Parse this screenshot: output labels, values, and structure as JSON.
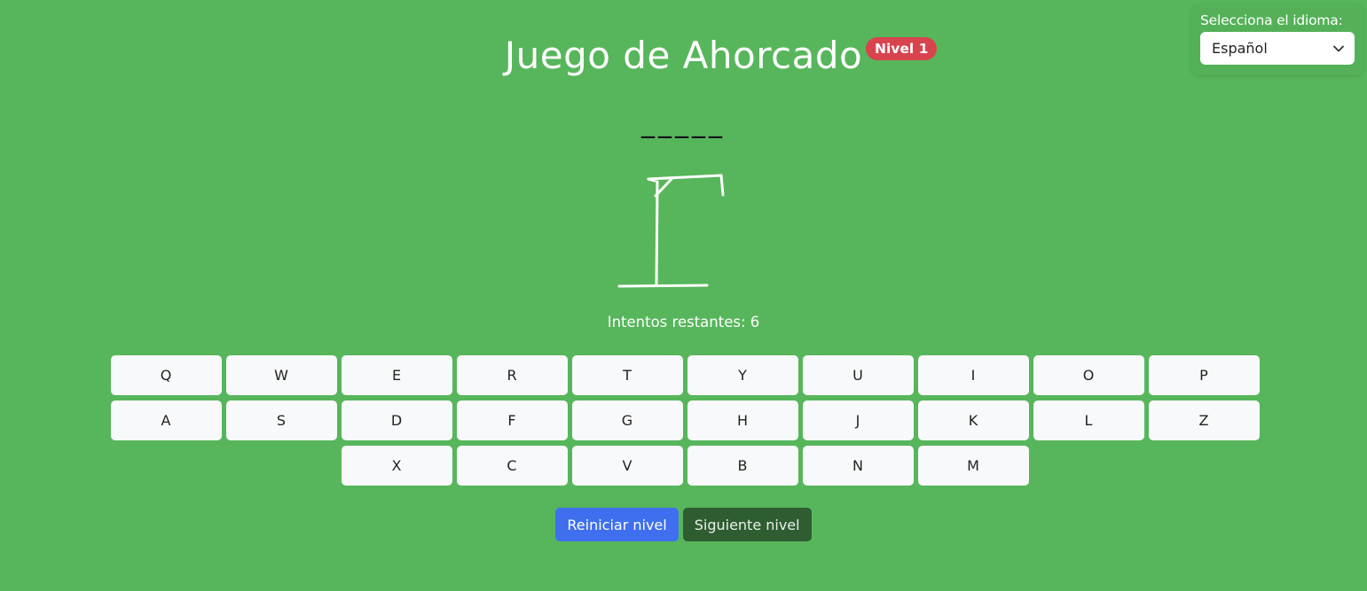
{
  "language": {
    "label": "Selecciona el idioma:",
    "selected": "Español"
  },
  "header": {
    "title": "Juego de Ahorcado",
    "level_badge": "Nivel 1"
  },
  "word_display": "_____",
  "attempts_text": "Intentos restantes: 6",
  "keyboard": {
    "row1": [
      "Q",
      "W",
      "E",
      "R",
      "T",
      "Y",
      "U",
      "I",
      "O",
      "P"
    ],
    "row2": [
      "A",
      "S",
      "D",
      "F",
      "G",
      "H",
      "J",
      "K",
      "L",
      "Z"
    ],
    "row3": [
      "X",
      "C",
      "V",
      "B",
      "N",
      "M"
    ]
  },
  "actions": {
    "restart_label": "Reiniciar nivel",
    "next_label": "Siguiente nivel"
  },
  "colors": {
    "background": "#57b65b",
    "badge": "#d9434d",
    "primary": "#3f6fef",
    "dark": "#2f5d32"
  }
}
